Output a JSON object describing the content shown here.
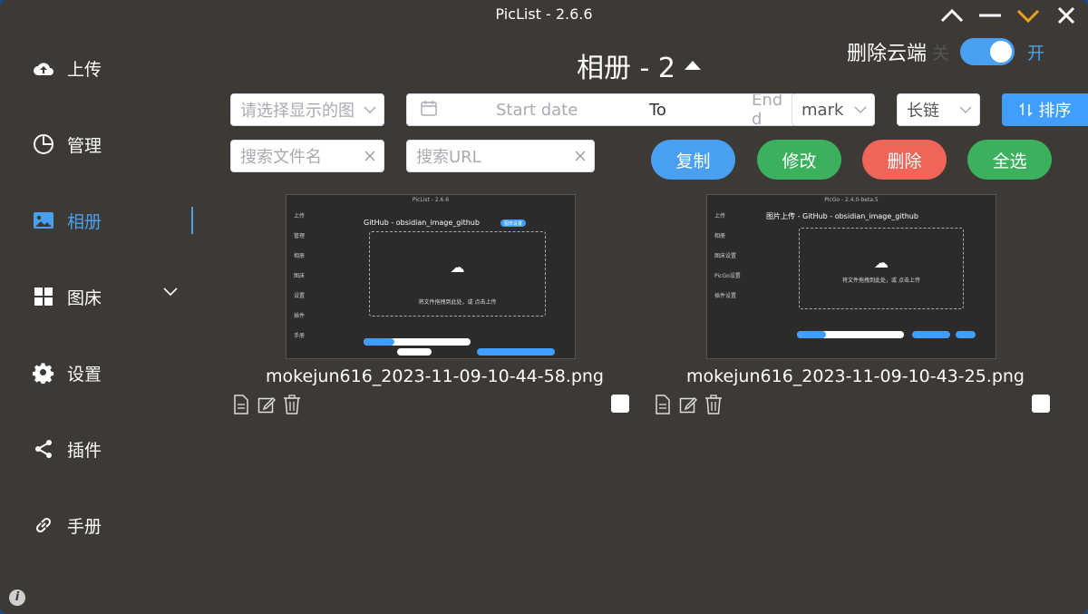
{
  "window": {
    "title": "PicList - 2.6.6"
  },
  "sidebar": {
    "items": [
      {
        "label": "上传",
        "icon": "cloud-upload-icon"
      },
      {
        "label": "管理",
        "icon": "pie-chart-icon"
      },
      {
        "label": "相册",
        "icon": "picture-icon"
      },
      {
        "label": "图床",
        "icon": "grid-icon"
      },
      {
        "label": "设置",
        "icon": "gear-icon"
      },
      {
        "label": "插件",
        "icon": "share-icon"
      },
      {
        "label": "手册",
        "icon": "link-icon"
      }
    ],
    "active": "相册"
  },
  "header": {
    "album_title": "相册 - 2",
    "cloud_delete_label": "删除云端",
    "switch_off": "关",
    "switch_on": "开"
  },
  "filters": {
    "select_placeholder": "请选择显示的图",
    "start_date": "Start date",
    "to": "To",
    "end_date": "End d",
    "format_value": "mark",
    "link_value": "长链",
    "sort_label": "排序",
    "search_filename_placeholder": "搜索文件名",
    "search_url_placeholder": "搜索URL"
  },
  "actions": {
    "copy": "复制",
    "edit": "修改",
    "delete": "删除",
    "select_all": "全选"
  },
  "colors": {
    "accent": "#409eff",
    "copy": "#4aa0f0",
    "edit": "#3cb15d",
    "delete": "#f0655a",
    "select_all": "#3cb15d",
    "bg": "#3d3a36"
  },
  "images": [
    {
      "filename": "mokejun616_2023-11-09-10-44-58.png",
      "preview": {
        "title": "PicList - 2.6.6",
        "head": "GitHub - obsidian_image_github",
        "badge": "图床设置",
        "hint": "将文件拖拽到此处，或 点击上传",
        "side": [
          "上传",
          "管理",
          "相册",
          "图床",
          "设置",
          "插件",
          "手册"
        ]
      }
    },
    {
      "filename": "mokejun616_2023-11-09-10-43-25.png",
      "preview": {
        "title": "PicGo - 2.4.0-beta.5",
        "head": "图片上传 - GitHub - obsidian_image_github",
        "badge": "",
        "hint": "将文件拖拽到此处，或 点击上传",
        "side": [
          "上传",
          "相册",
          "图床设置",
          "PicGo设置",
          "插件设置"
        ]
      }
    }
  ]
}
